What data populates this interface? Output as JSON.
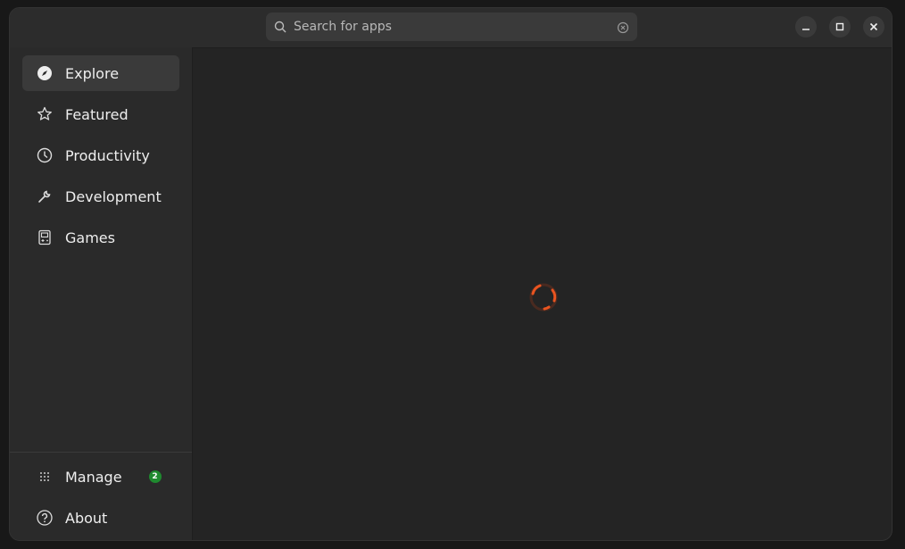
{
  "search": {
    "placeholder": "Search for apps"
  },
  "window_controls": {
    "minimize": "minimize-icon",
    "maximize": "maximize-icon",
    "close": "close-icon"
  },
  "sidebar": {
    "items": [
      {
        "label": "Explore",
        "icon": "compass-icon",
        "active": true
      },
      {
        "label": "Featured",
        "icon": "star-icon"
      },
      {
        "label": "Productivity",
        "icon": "clock-icon"
      },
      {
        "label": "Development",
        "icon": "wrench-icon"
      },
      {
        "label": "Games",
        "icon": "gameboy-icon"
      }
    ],
    "bottom": [
      {
        "label": "Manage",
        "icon": "grid-icon",
        "badge": "2"
      },
      {
        "label": "About",
        "icon": "help-icon"
      }
    ]
  },
  "main": {
    "state": "loading",
    "accent": "#e95420"
  }
}
